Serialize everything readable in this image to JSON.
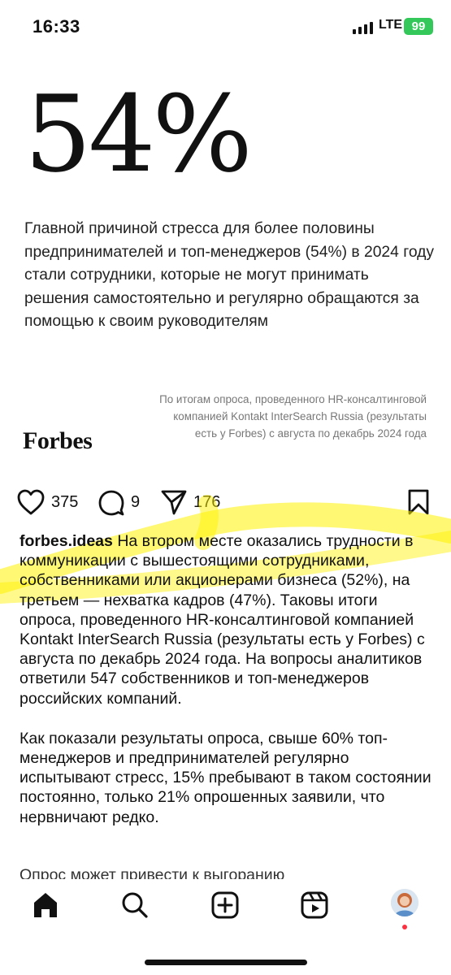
{
  "status_bar": {
    "time": "16:33",
    "network": "LTE",
    "battery": "99"
  },
  "post_image": {
    "big_stat": "54%",
    "headline": "Главной причиной стресса для более половины предпринимателей и топ-менеджеров (54%) в 2024 году стали сотрудники, которые не могут принимать решения самостоятельно и регулярно обращаются за помощью к своим руководителям",
    "brand": "Forbes",
    "source_note": "По итогам опроса, проведенного HR-консалтинговой компанией Kontakt InterSearch Russia (результаты есть у Forbes) с августа по декабрь 2024 года"
  },
  "actions": {
    "likes": "375",
    "comments": "9",
    "shares": "176"
  },
  "caption": {
    "username": "forbes.ideas",
    "paragraph1": "На втором месте оказались трудности в коммуникации с вышестоящими сотрудниками, собственниками или акционерами бизнеса (52%), на третьем — нехватка кадров (47%). Таковы итоги опроса, проведенного HR-консалтинговой компанией Kontakt InterSearch Russia (результаты есть у Forbes) с августа по декабрь 2024 года. На вопросы аналитиков ответили 547 собственников и топ-менеджеров российских компаний.",
    "paragraph2": "Как показали результаты опроса, свыше 60% топ-менеджеров и предпринимателей регулярно испытывают стресс, 15% пребывают в таком состоянии постоянно, только 21% опрошенных заявили, что нервничают редко.",
    "paragraph3_partial": "Опрос может привести к выгоранию"
  },
  "colors": {
    "highlight": "#fff200",
    "battery": "#34c759",
    "notification_dot": "#ff3040"
  },
  "tab_bar": {
    "icons": [
      "home-icon",
      "search-icon",
      "create-icon",
      "reels-icon",
      "profile-avatar"
    ]
  }
}
